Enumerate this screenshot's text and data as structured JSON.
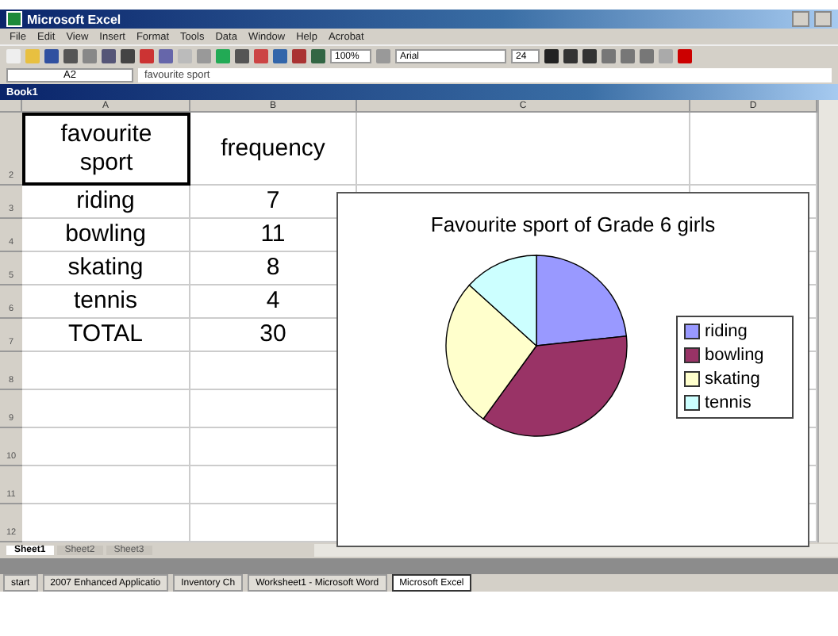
{
  "window": {
    "title": "Microsoft Excel"
  },
  "menu": [
    "File",
    "Edit",
    "View",
    "Insert",
    "Format",
    "Tools",
    "Data",
    "Window",
    "Help",
    "Acrobat"
  ],
  "toolbar": {
    "zoom": "100%",
    "font": "Arial",
    "size": "24"
  },
  "formula_bar": {
    "name_box": "A2",
    "value": "favourite sport"
  },
  "workbook": {
    "title": "Book1"
  },
  "columns": [
    "A",
    "B",
    "C",
    "D"
  ],
  "rows": [
    {
      "number": "2",
      "cells": [
        "favourite sport",
        "frequency"
      ],
      "selected": true
    },
    {
      "number": "3",
      "cells": [
        "riding",
        "7"
      ],
      "selected": false
    },
    {
      "number": "4",
      "cells": [
        "bowling",
        "11"
      ],
      "selected": false
    },
    {
      "number": "5",
      "cells": [
        "skating",
        "8"
      ],
      "selected": false
    },
    {
      "number": "6",
      "cells": [
        "tennis",
        "4"
      ],
      "selected": false
    },
    {
      "number": "7",
      "cells": [
        "TOTAL",
        "30"
      ],
      "selected": false
    },
    {
      "number": "8",
      "cells": [],
      "selected": false
    },
    {
      "number": "9",
      "cells": [],
      "selected": false
    },
    {
      "number": "10",
      "cells": [],
      "selected": false
    },
    {
      "number": "11",
      "cells": [],
      "selected": false
    },
    {
      "number": "12",
      "cells": [],
      "selected": false
    }
  ],
  "chart": {
    "chart_data": {
      "type": "pie",
      "title": "Favourite sport of Grade 6 girls",
      "categories": [
        "riding",
        "bowling",
        "skating",
        "tennis"
      ],
      "series": [
        {
          "values": [
            23.3,
            36.7,
            26.7,
            13.3
          ]
        }
      ],
      "legend": "right"
    },
    "slices": [
      {
        "color": "#9999ff"
      },
      {
        "color": "#993366"
      },
      {
        "color": "#ffffcc"
      },
      {
        "color": "#ccffff"
      }
    ]
  },
  "sheet_tabs": [
    {
      "label": "Sheet1",
      "selected": true
    },
    {
      "label": "Sheet2",
      "selected": false
    },
    {
      "label": "Sheet3",
      "selected": false
    }
  ],
  "taskbar": [
    {
      "label": "start",
      "selected": false
    },
    {
      "label": "2007 Enhanced Applicatio",
      "selected": false
    },
    {
      "label": "Inventory Ch",
      "selected": false
    },
    {
      "label": "Worksheet1 - Microsoft Word",
      "selected": false
    },
    {
      "label": "Microsoft Excel",
      "selected": true
    }
  ]
}
